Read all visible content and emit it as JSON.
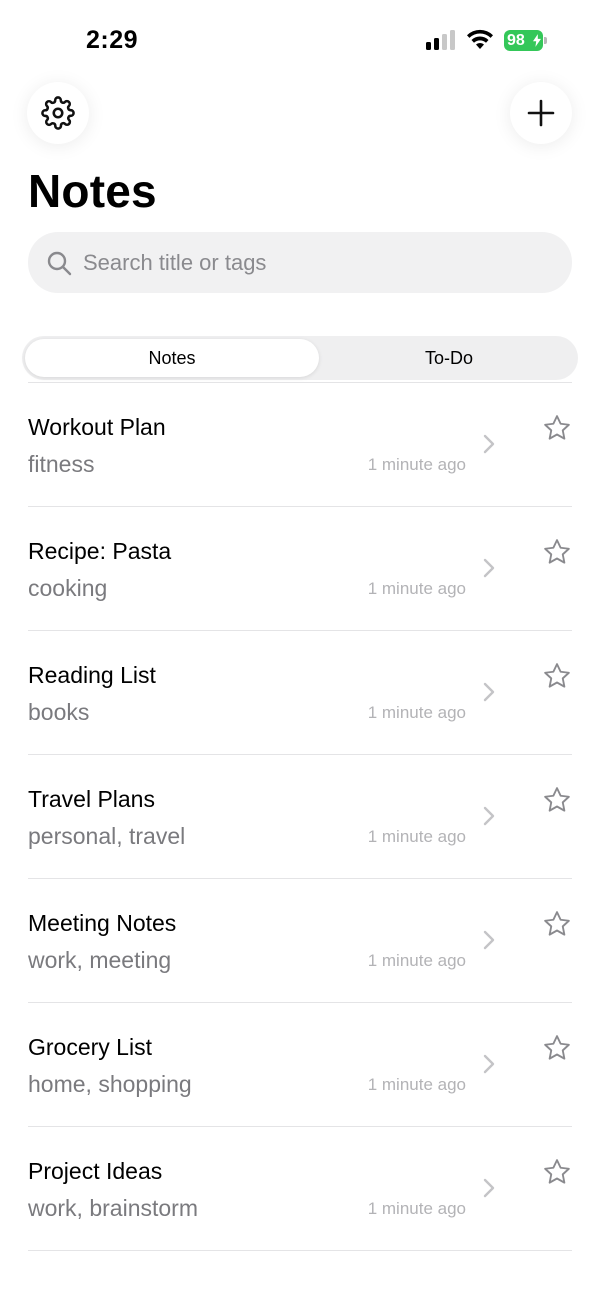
{
  "status_bar": {
    "time": "2:29",
    "battery_level": "98",
    "battery_color": "#34c759"
  },
  "header": {
    "settings_icon": "gear-icon",
    "add_icon": "plus-icon",
    "title": "Notes"
  },
  "search": {
    "icon": "search-icon",
    "placeholder": "Search title or tags",
    "value": ""
  },
  "segments": [
    {
      "label": "Notes",
      "selected": true
    },
    {
      "label": "To-Do",
      "selected": false
    }
  ],
  "notes": [
    {
      "title": "Workout Plan",
      "tags": "fitness",
      "time": "1 minute ago",
      "starred": false
    },
    {
      "title": "Recipe: Pasta",
      "tags": "cooking",
      "time": "1 minute ago",
      "starred": false
    },
    {
      "title": "Reading List",
      "tags": "books",
      "time": "1 minute ago",
      "starred": false
    },
    {
      "title": "Travel Plans",
      "tags": "personal, travel",
      "time": "1 minute ago",
      "starred": false
    },
    {
      "title": "Meeting Notes",
      "tags": "work, meeting",
      "time": "1 minute ago",
      "starred": false
    },
    {
      "title": "Grocery List",
      "tags": "home, shopping",
      "time": "1 minute ago",
      "starred": false
    },
    {
      "title": "Project Ideas",
      "tags": "work, brainstorm",
      "time": "1 minute ago",
      "starred": false
    }
  ]
}
